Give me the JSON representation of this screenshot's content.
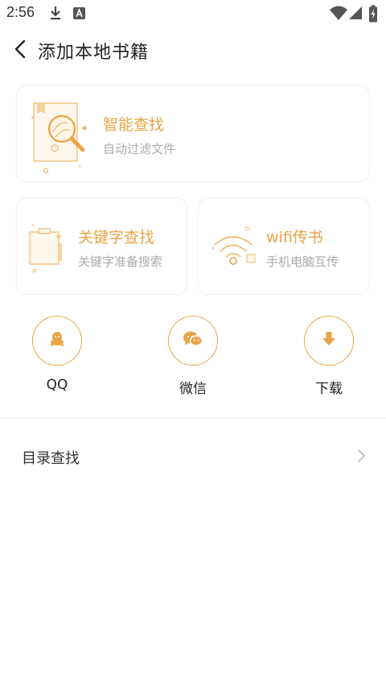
{
  "status_bar": {
    "time": "2:56",
    "icons": [
      "download-icon",
      "notification-a-icon",
      "wifi-icon",
      "signal-icon",
      "battery-charging-icon"
    ]
  },
  "header": {
    "title": "添加本地书籍",
    "back_icon": "chevron-left-icon"
  },
  "smart_find": {
    "title": "智能查找",
    "subtitle": "自动过滤文件",
    "icon": "document-magnifier-icon"
  },
  "keyword_find": {
    "title": "关键字查找",
    "subtitle": "关键字准备搜索",
    "icon": "clipboard-icon"
  },
  "wifi_transfer": {
    "title": "wifi传书",
    "subtitle": "手机电脑互传",
    "icon": "wifi-icon"
  },
  "share_sources": [
    {
      "label": "QQ",
      "icon": "qq-penguin-icon"
    },
    {
      "label": "微信",
      "icon": "wechat-icon"
    },
    {
      "label": "下载",
      "icon": "download-arrow-icon"
    }
  ],
  "directory_find": {
    "label": "目录查找",
    "icon": "chevron-right-icon"
  },
  "colors": {
    "accent": "#e8a447",
    "accent_light": "#f5d2a2",
    "subtitle_gray": "#aaaaaa"
  }
}
